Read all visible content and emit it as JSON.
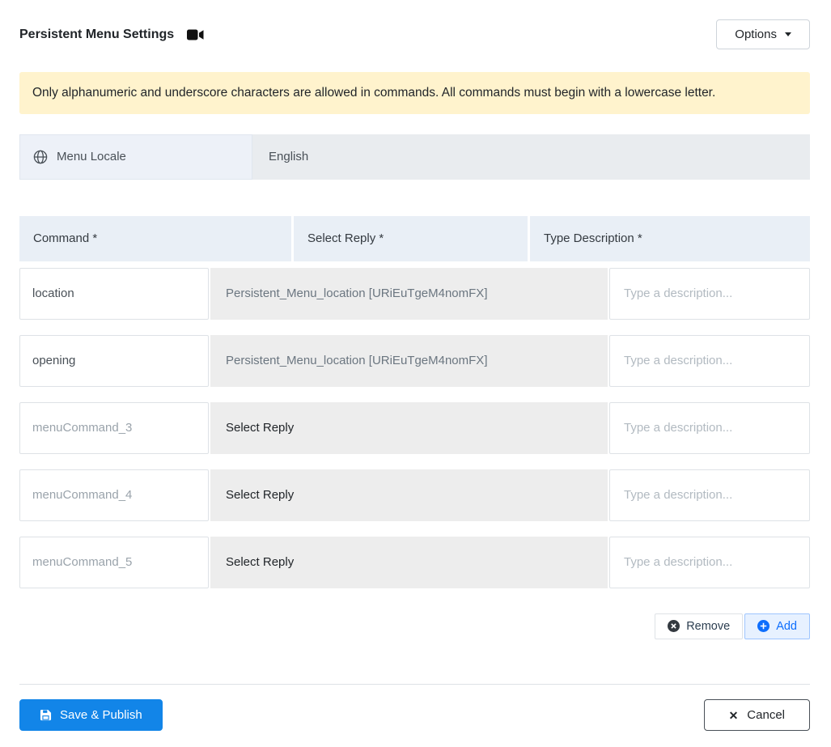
{
  "header": {
    "title": "Persistent Menu Settings",
    "options_label": "Options"
  },
  "alert": {
    "message": "Only alphanumeric and underscore characters are allowed in commands. All commands must begin with a lowercase letter."
  },
  "locale": {
    "label": "Menu Locale",
    "value": "English"
  },
  "table": {
    "headers": {
      "command": "Command *",
      "reply": "Select Reply *",
      "description": "Type Description *"
    },
    "rows": [
      {
        "command_value": "location",
        "command_placeholder": "",
        "reply": "Persistent_Menu_location [URiEuTgeM4nomFX]",
        "reply_selected": true,
        "description_value": "",
        "description_placeholder": "Type a description..."
      },
      {
        "command_value": "opening",
        "command_placeholder": "",
        "reply": "Persistent_Menu_location [URiEuTgeM4nomFX]",
        "reply_selected": true,
        "description_value": "",
        "description_placeholder": "Type a description..."
      },
      {
        "command_value": "",
        "command_placeholder": "menuCommand_3",
        "reply": "Select Reply",
        "reply_selected": false,
        "description_value": "",
        "description_placeholder": "Type a description..."
      },
      {
        "command_value": "",
        "command_placeholder": "menuCommand_4",
        "reply": "Select Reply",
        "reply_selected": false,
        "description_value": "",
        "description_placeholder": "Type a description..."
      },
      {
        "command_value": "",
        "command_placeholder": "menuCommand_5",
        "reply": "Select Reply",
        "reply_selected": false,
        "description_value": "",
        "description_placeholder": "Type a description..."
      }
    ],
    "remove_label": "Remove",
    "add_label": "Add"
  },
  "footer": {
    "save_label": "Save & Publish",
    "cancel_label": "Cancel"
  },
  "colors": {
    "accent_blue": "#1285e8",
    "add_blue": "#0d6efd",
    "alert_bg": "#fff3cd",
    "table_header_bg": "#e9eff6",
    "locale_label_bg": "#edf1f8",
    "locale_value_bg": "#e9ecef",
    "reply_cell_bg": "#ededed"
  }
}
